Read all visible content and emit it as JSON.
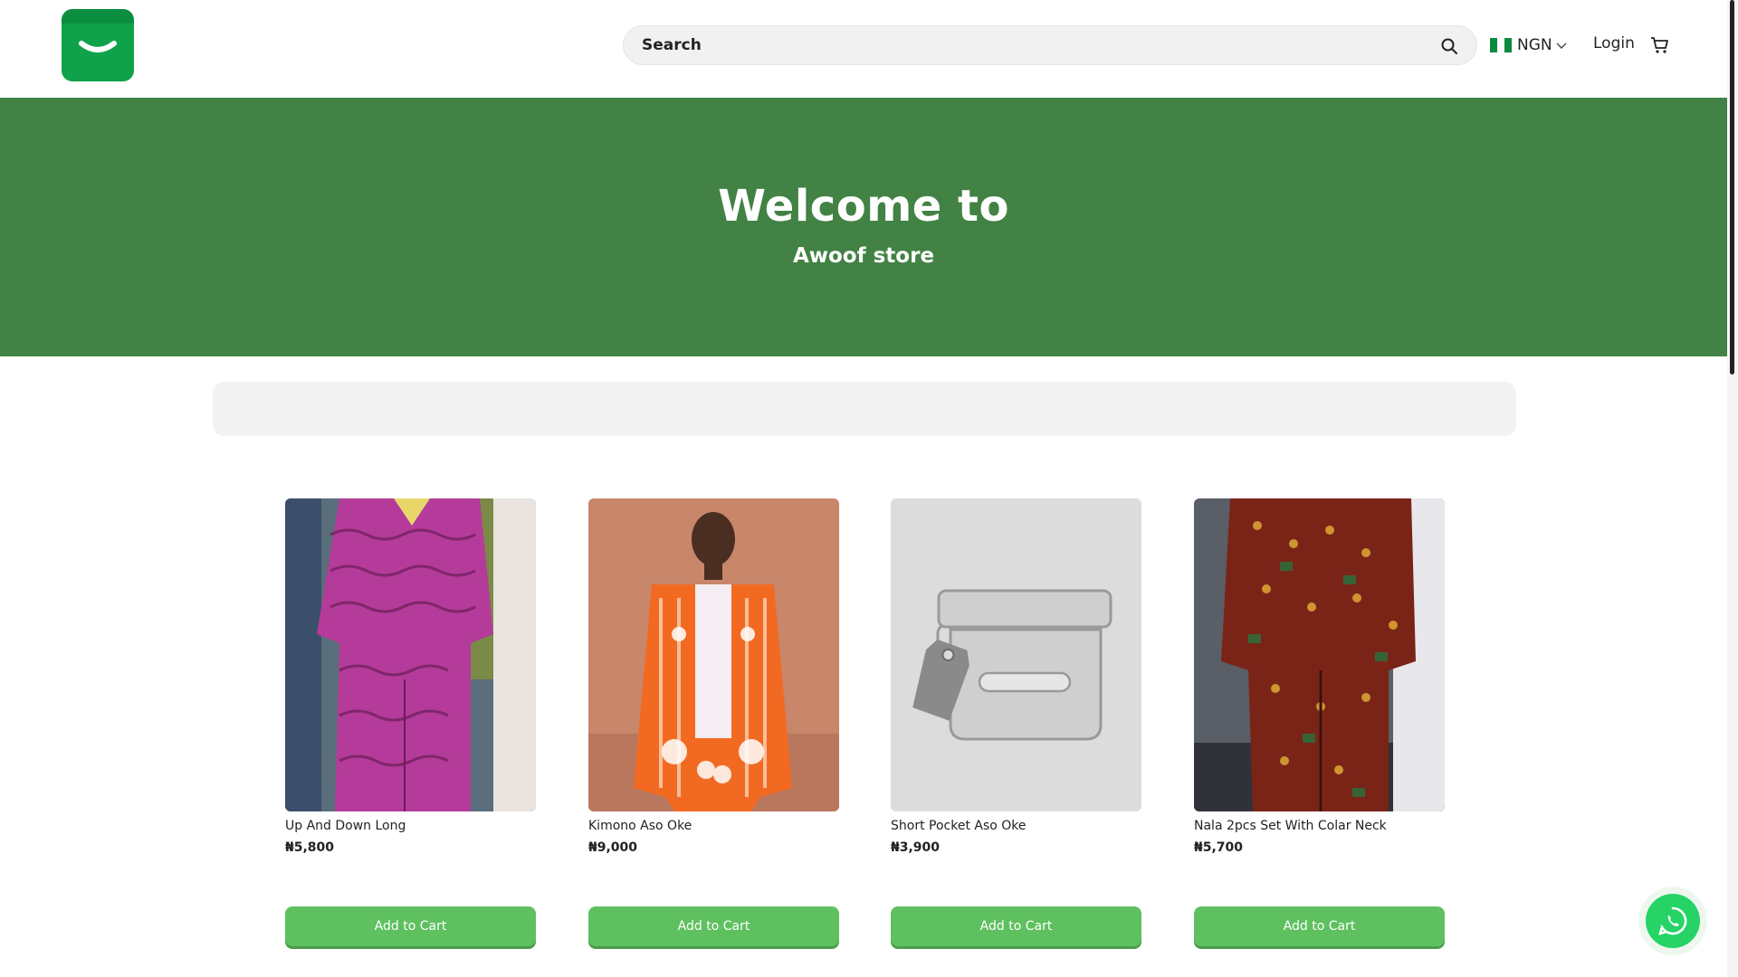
{
  "header": {
    "logo_icon": "smile-bag-icon",
    "search_placeholder": "Search",
    "currency": "NGN",
    "login_label": "Login",
    "cart_icon": "cart-icon"
  },
  "hero": {
    "title": "Welcome to",
    "subtitle": "Awoof store"
  },
  "products": [
    {
      "name": "Up And Down Long",
      "price": "₦5,800",
      "button": "Add to Cart"
    },
    {
      "name": "Kimono Aso Oke",
      "price": "₦9,000",
      "button": "Add to Cart"
    },
    {
      "name": "Short Pocket Aso Oke",
      "price": "₦3,900",
      "button": "Add to Cart"
    },
    {
      "name": "Nala 2pcs Set With Colar Neck",
      "price": "₦5,700",
      "button": "Add to Cart"
    }
  ],
  "colors": {
    "brand_green": "#10a24a",
    "hero_green": "#428244",
    "button_green": "#5fc060",
    "whatsapp_green": "#25d366"
  }
}
